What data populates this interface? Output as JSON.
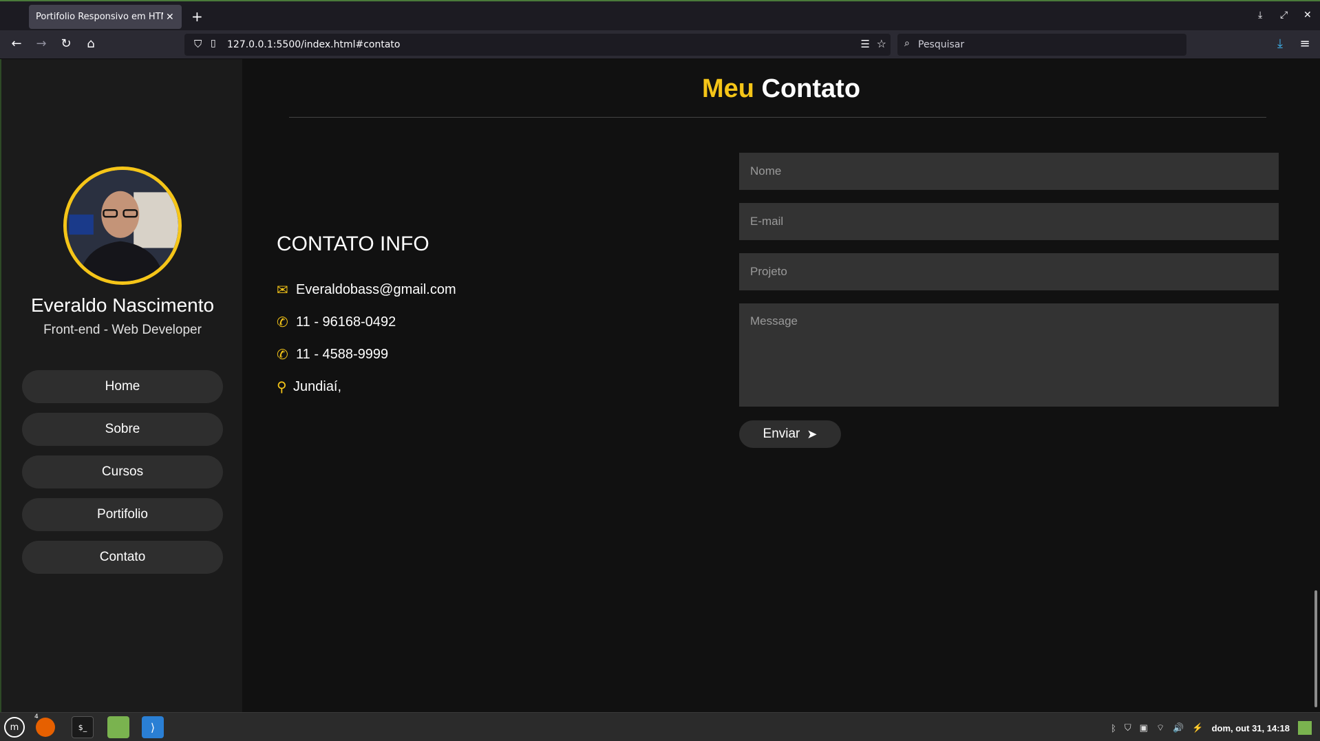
{
  "browser": {
    "tab_title": "Portifolio Responsivo em HTML",
    "url": "127.0.0.1:5500/index.html#contato",
    "search_placeholder": "Pesquisar"
  },
  "sidebar": {
    "name": "Everaldo Nascimento",
    "role": "Front-end - Web Developer",
    "menu": [
      "Home",
      "Sobre",
      "Cursos",
      "Portifolio",
      "Contato"
    ]
  },
  "section": {
    "title_accent": "Meu",
    "title_rest": "Contato"
  },
  "info": {
    "heading": "CONTATO INFO",
    "email": "Everaldobass@gmail.com",
    "phone1": "11 - 96168-0492",
    "phone2": "11 - 4588-9999",
    "location": "Jundiaí,"
  },
  "form": {
    "name_placeholder": "Nome",
    "email_placeholder": "E-mail",
    "project_placeholder": "Projeto",
    "message_placeholder": "Message",
    "send_label": "Enviar"
  },
  "taskbar": {
    "clock": "dom, out 31, 14:18",
    "firefox_badge": "4"
  },
  "colors": {
    "accent": "#f5c518",
    "background": "#111111",
    "sidebar": "#1b1b1b",
    "field": "#333333"
  }
}
